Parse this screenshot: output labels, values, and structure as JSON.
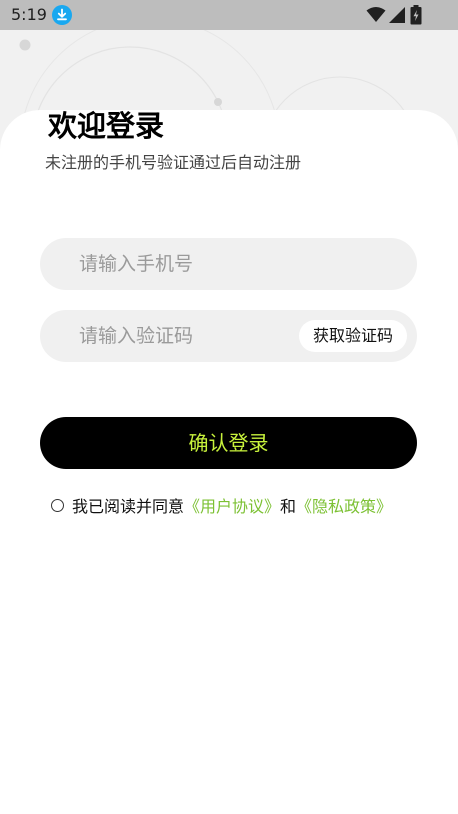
{
  "status_bar": {
    "time": "5:19"
  },
  "header": {
    "title": "欢迎登录",
    "subtitle": "未注册的手机号验证通过后自动注册"
  },
  "form": {
    "phone_placeholder": "请输入手机号",
    "phone_value": "",
    "code_placeholder": "请输入验证码",
    "code_value": "",
    "get_code_label": "获取验证码",
    "submit_label": "确认登录"
  },
  "agreement": {
    "prefix": "我已阅读并同意",
    "user_agreement": "《用户协议》",
    "joiner": "和",
    "privacy_policy": "《隐私政策》",
    "checked": false
  },
  "colors": {
    "accent": "#c8f23c",
    "link": "#7cc133",
    "button_bg": "#000000",
    "input_bg": "#f0f0f0",
    "status_bar_bg": "#bdbdbd",
    "download_badge": "#19a8f0"
  },
  "icons": {
    "download": "download-icon",
    "wifi": "wifi-icon",
    "signal": "signal-icon",
    "battery": "battery-charging-icon",
    "radio": "radio-unchecked-icon"
  }
}
